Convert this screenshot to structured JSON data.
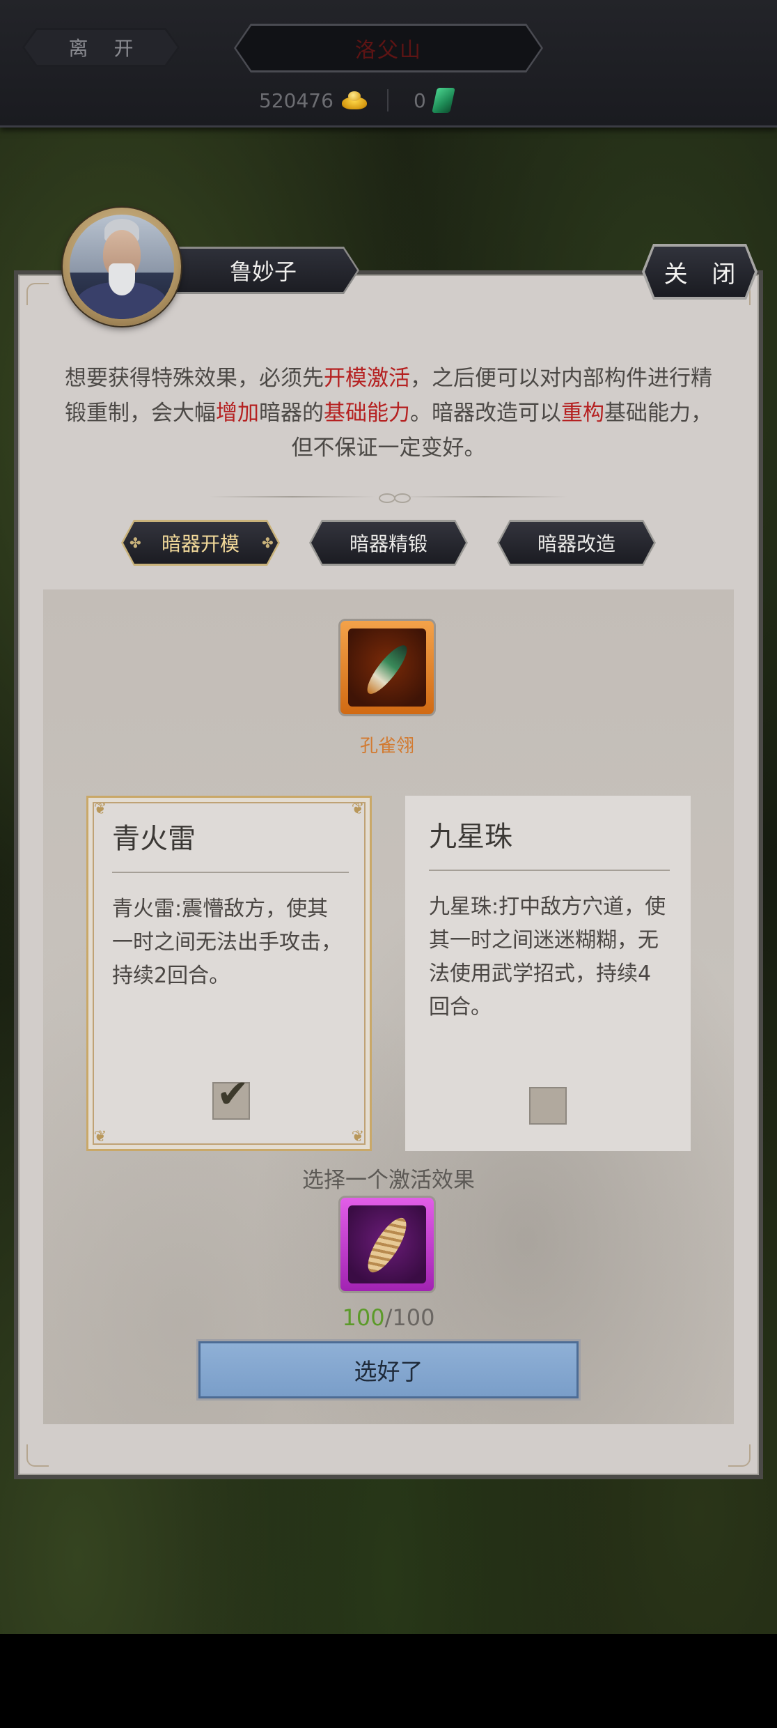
{
  "top": {
    "leave_label": "离 开",
    "location": "洛父山",
    "gold_amount": "520476",
    "jade_amount": "0"
  },
  "npc": {
    "name": "鲁妙子",
    "close_label": "关 闭"
  },
  "description": {
    "segments": [
      {
        "text": "想要获得特殊效果，必须先",
        "highlight": false
      },
      {
        "text": "开模激活",
        "highlight": true
      },
      {
        "text": "，之后便可以对内部构件进行精锻重制，会大幅",
        "highlight": false
      },
      {
        "text": "增加",
        "highlight": true
      },
      {
        "text": "暗器的",
        "highlight": false
      },
      {
        "text": "基础能力",
        "highlight": true
      },
      {
        "text": "。暗器改造可以",
        "highlight": false
      },
      {
        "text": "重构",
        "highlight": true
      },
      {
        "text": "基础能力，但不保证一定变好。",
        "highlight": false
      }
    ]
  },
  "tabs": [
    {
      "label": "暗器开模",
      "active": true
    },
    {
      "label": "暗器精锻",
      "active": false
    },
    {
      "label": "暗器改造",
      "active": false
    }
  ],
  "weapon": {
    "name": "孔雀翎",
    "rarity_color": "#e0801e",
    "icon": "peacock-feather-icon"
  },
  "effects": [
    {
      "title": "青火雷",
      "description": "青火雷:震懵敌方，使其一时之间无法出手攻击，持续2回合。",
      "selected": true
    },
    {
      "title": "九星珠",
      "description": "九星珠:打中敌方穴道，使其一时之间迷迷糊糊，无法使用武学招式，持续4回合。",
      "selected": false
    }
  ],
  "prompt": "选择一个激活效果",
  "material": {
    "icon": "silk-cocoon-icon",
    "rarity_color": "#c03ad0",
    "have": "100",
    "need": "/100"
  },
  "confirm_label": "选好了",
  "colors": {
    "highlight": "#b52121",
    "confirm_button": "#8fb0d6",
    "tab_active_text": "#f2d99a"
  }
}
